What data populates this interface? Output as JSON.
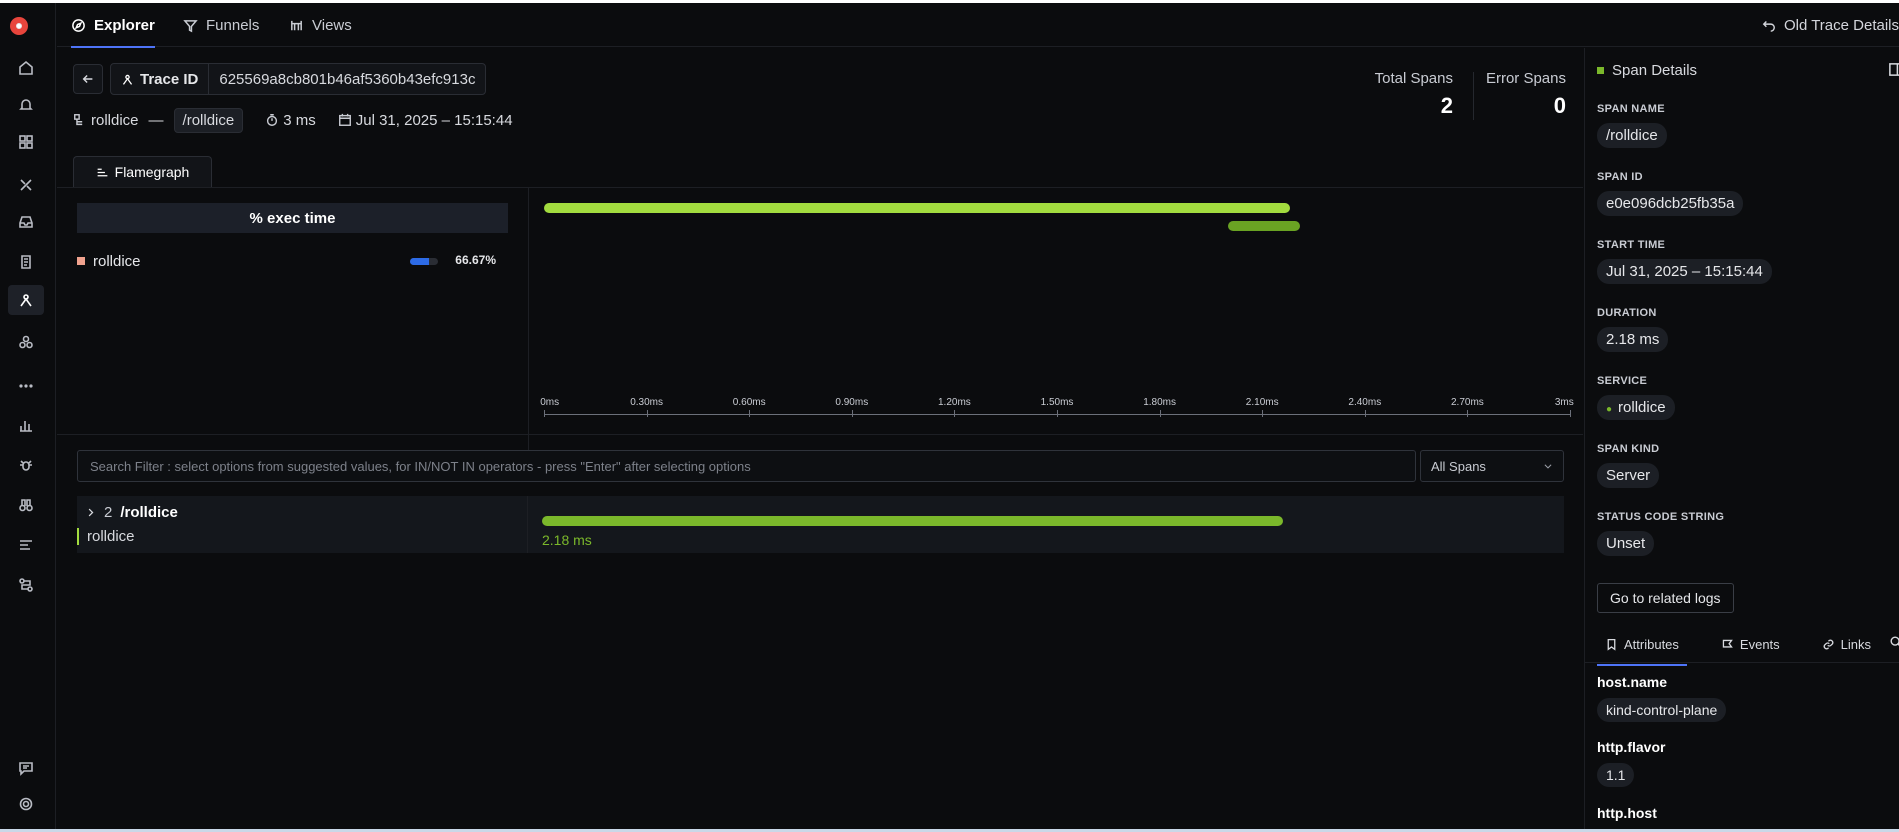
{
  "nav": {
    "tabs": [
      {
        "label": "Explorer",
        "icon": "compass-icon"
      },
      {
        "label": "Funnels",
        "icon": "funnel-icon"
      },
      {
        "label": "Views",
        "icon": "views-icon"
      }
    ],
    "old_trace_label": "Old Trace Details"
  },
  "trace": {
    "id_label": "Trace ID",
    "id_value": "625569a8cb801b46af5360b43efc913c",
    "service": "rolldice",
    "separator": "—",
    "root_span": "/rolldice",
    "duration": "3 ms",
    "timestamp": "Jul 31, 2025 – 15:15:44",
    "total_spans_label": "Total Spans",
    "total_spans": "2",
    "error_spans_label": "Error Spans",
    "error_spans": "0"
  },
  "flamegraph": {
    "tab_label": "Flamegraph",
    "exec_header": "% exec time",
    "exec_rows": [
      {
        "service": "rolldice",
        "percent": "66.67%",
        "fraction": 0.6667,
        "color": "#f0a28e"
      }
    ],
    "axis_ticks": [
      "0ms",
      "0.30ms",
      "0.60ms",
      "0.90ms",
      "1.20ms",
      "1.50ms",
      "1.80ms",
      "2.10ms",
      "2.40ms",
      "2.70ms",
      "3ms"
    ],
    "bars": [
      {
        "start_ms": 0,
        "end_ms": 2.18,
        "level": 0,
        "color": "#a3dc3f"
      },
      {
        "start_ms": 2.0,
        "end_ms": 2.21,
        "level": 1,
        "color": "#6aa323"
      }
    ]
  },
  "filter": {
    "placeholder": "Search Filter : select options from suggested values, for IN/NOT IN operators - press \"Enter\" after selecting options",
    "select_value": "All Spans"
  },
  "span_list": [
    {
      "child_count": "2",
      "name": "/rolldice",
      "service": "rolldice",
      "duration": "2.18 ms"
    }
  ],
  "details": {
    "title": "Span Details",
    "fields": [
      {
        "key": "SPAN NAME",
        "value": "/rolldice"
      },
      {
        "key": "SPAN ID",
        "value": "e0e096dcb25fb35a"
      },
      {
        "key": "START TIME",
        "value": "Jul 31, 2025 – 15:15:44"
      },
      {
        "key": "DURATION",
        "value": "2.18 ms"
      },
      {
        "key": "SERVICE",
        "value": "rolldice"
      },
      {
        "key": "SPAN KIND",
        "value": "Server"
      },
      {
        "key": "STATUS CODE STRING",
        "value": "Unset"
      }
    ],
    "related_logs_button": "Go to related logs",
    "tabs": [
      "Attributes",
      "Events",
      "Links"
    ],
    "attributes": [
      {
        "key": "host.name",
        "value": "kind-control-plane"
      },
      {
        "key": "http.flavor",
        "value": "1.1"
      },
      {
        "key": "http.host",
        "value": ""
      }
    ]
  },
  "colors": {
    "accent": "#4e74f8",
    "span_green": "#a3dc3f",
    "span_dark_green": "#7bb82b"
  }
}
